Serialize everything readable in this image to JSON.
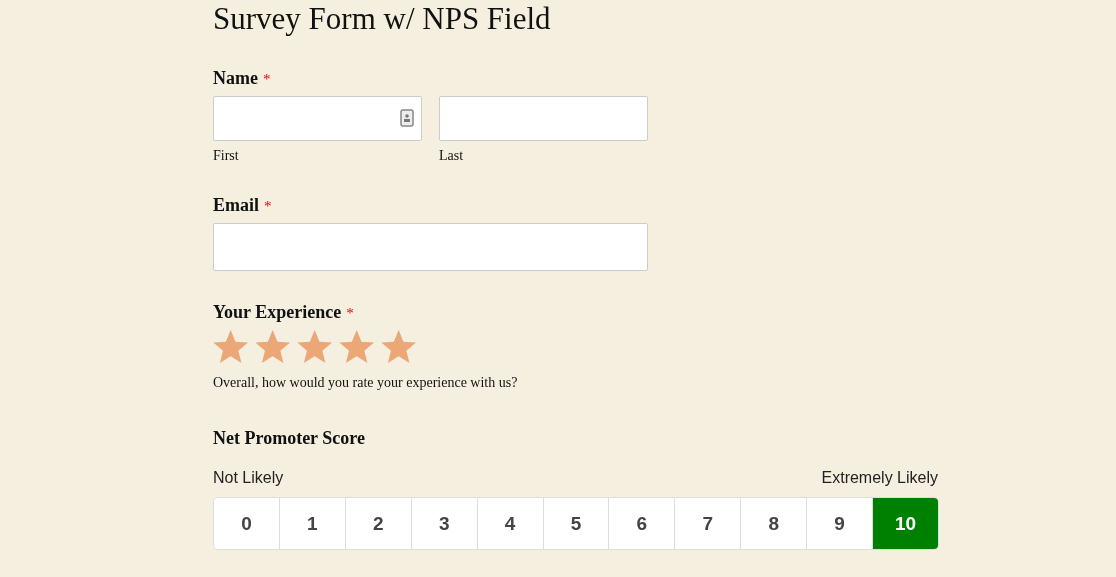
{
  "title": "Survey Form w/ NPS Field",
  "name_field": {
    "label": "Name",
    "required_mark": "*",
    "parts": [
      {
        "sublabel": "First",
        "contact_icon": true
      },
      {
        "sublabel": "Last",
        "contact_icon": false
      }
    ]
  },
  "email_field": {
    "label": "Email",
    "required_mark": "*"
  },
  "experience": {
    "label": "Your Experience",
    "required_mark": "*",
    "stars": 5,
    "description": "Overall, how would you rate your experience with us?"
  },
  "nps": {
    "label": "Net Promoter Score",
    "low_label": "Not Likely",
    "high_label": "Extremely Likely",
    "options": [
      {
        "label": "0",
        "selected": false
      },
      {
        "label": "1",
        "selected": false
      },
      {
        "label": "2",
        "selected": false
      },
      {
        "label": "3",
        "selected": false
      },
      {
        "label": "4",
        "selected": false
      },
      {
        "label": "5",
        "selected": false
      },
      {
        "label": "6",
        "selected": false
      },
      {
        "label": "7",
        "selected": false
      },
      {
        "label": "8",
        "selected": false
      },
      {
        "label": "9",
        "selected": false
      },
      {
        "label": "10",
        "selected": true
      }
    ]
  }
}
